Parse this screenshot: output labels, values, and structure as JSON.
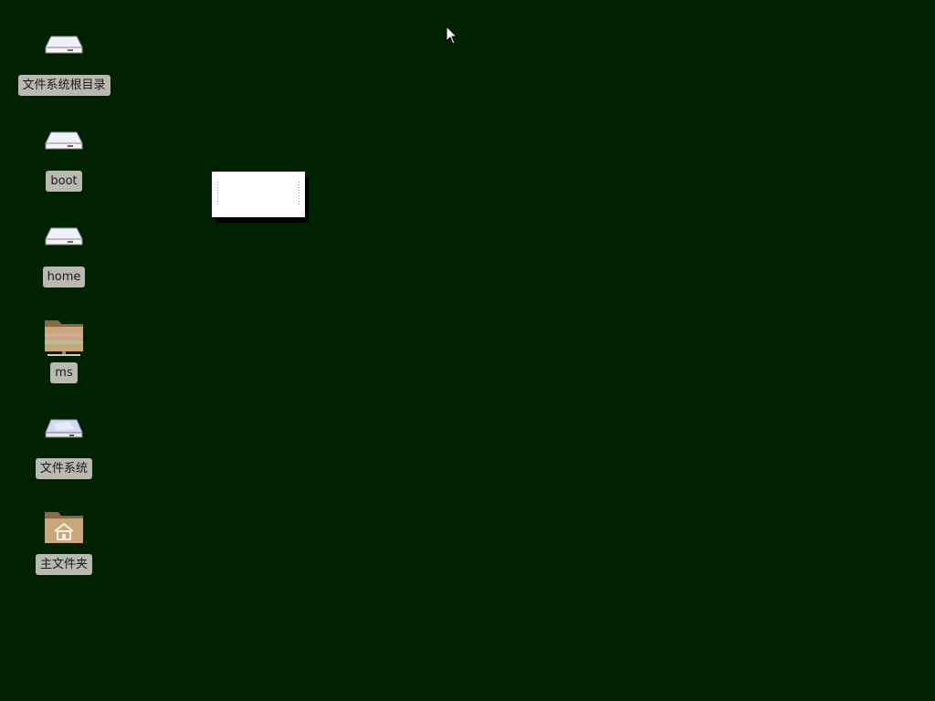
{
  "desktop": {
    "background": "#002200",
    "icons": [
      {
        "label": "文件系统根目录",
        "icon": "drive-icon"
      },
      {
        "label": "boot",
        "icon": "drive-icon"
      },
      {
        "label": "home",
        "icon": "drive-icon"
      },
      {
        "label": "ms",
        "icon": "network-folder-icon"
      },
      {
        "label": "文件系统",
        "icon": "filesystem-drive-icon"
      },
      {
        "label": "主文件夹",
        "icon": "home-folder-icon"
      }
    ]
  },
  "colors": {
    "label_bg": "#b9b9b1",
    "label_text": "#1a1a1a",
    "folder": "#c9a77a"
  }
}
